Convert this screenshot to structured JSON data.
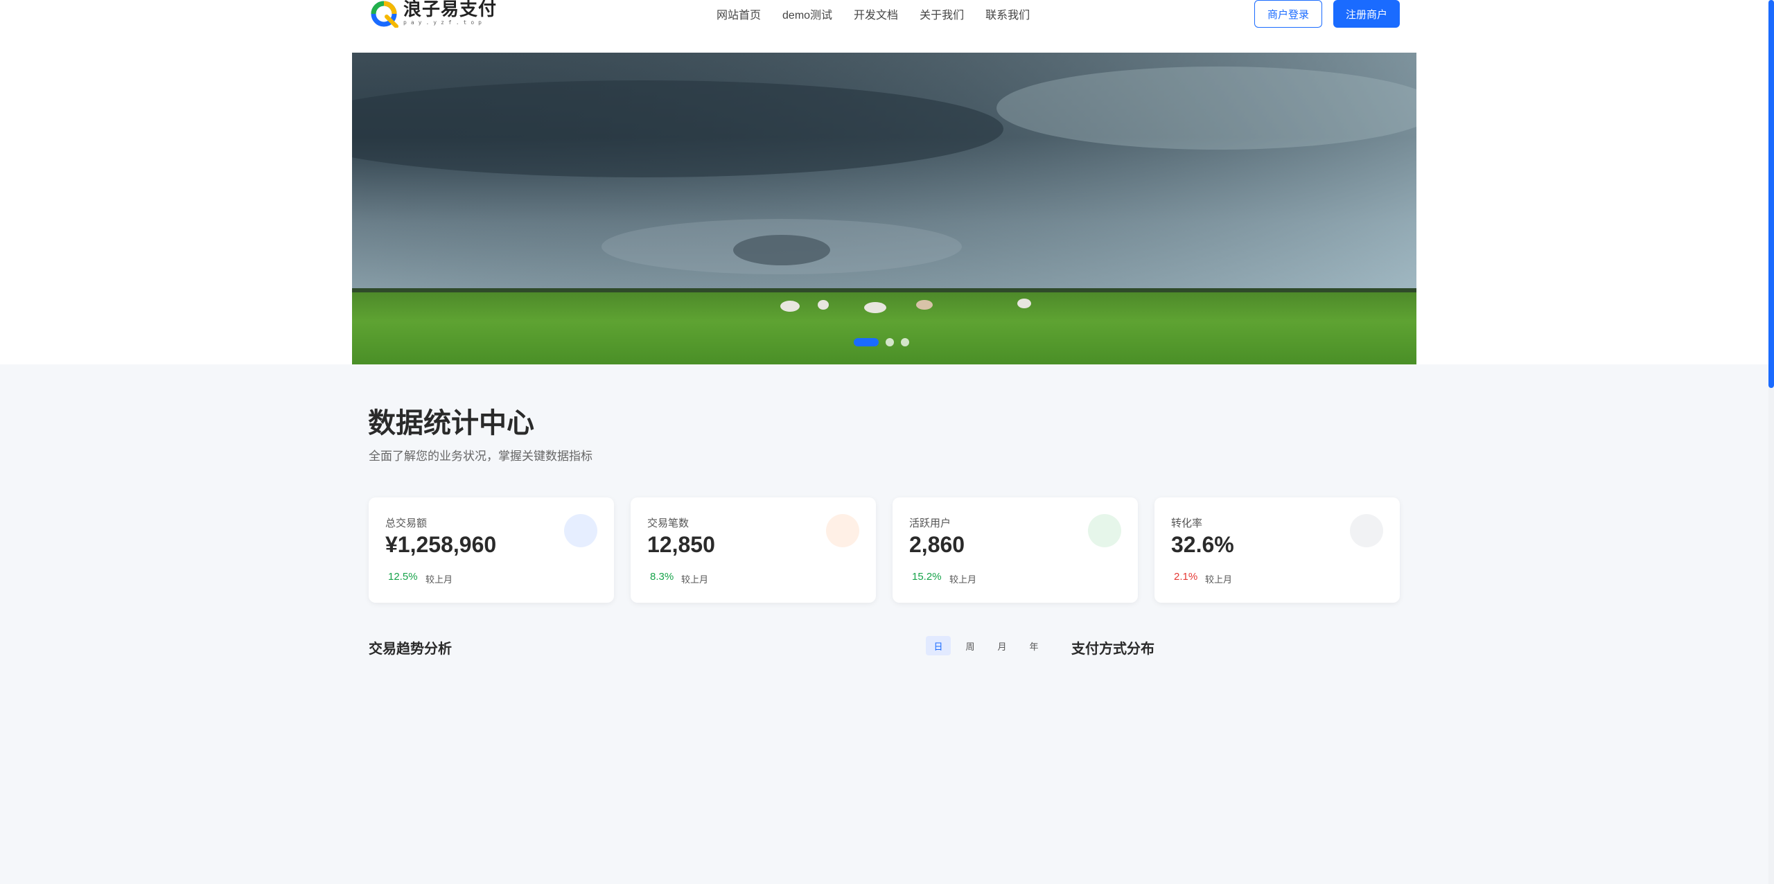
{
  "header": {
    "logo_title": "浪子易支付",
    "logo_sub": "pay.yzf.top",
    "nav": [
      "网站首页",
      "demo测试",
      "开发文档",
      "关于我们",
      "联系我们"
    ],
    "login_label": "商户登录",
    "register_label": "注册商户"
  },
  "banner": {
    "slide_count": 3,
    "active_slide": 1
  },
  "stats": {
    "title": "数据统计中心",
    "subtitle": "全面了解您的业务状况，掌握关键数据指标",
    "compare_label": "较上月",
    "cards": [
      {
        "label": "总交易额",
        "value": "¥1,258,960",
        "change": "12.5%",
        "trend": "up",
        "icon_color": "#e6eeff"
      },
      {
        "label": "交易笔数",
        "value": "12,850",
        "change": "8.3%",
        "trend": "up",
        "icon_color": "#fff0e6"
      },
      {
        "label": "活跃用户",
        "value": "2,860",
        "change": "15.2%",
        "trend": "up",
        "icon_color": "#e6f6ea"
      },
      {
        "label": "转化率",
        "value": "32.6%",
        "change": "2.1%",
        "trend": "down",
        "icon_color": "#f1f2f4"
      }
    ]
  },
  "charts": {
    "trend_title": "交易趋势分析",
    "payment_title": "支付方式分布",
    "periods": [
      "日",
      "周",
      "月",
      "年"
    ],
    "active_period": "日"
  },
  "colors": {
    "primary": "#1a6bff",
    "up": "#17a34a",
    "down": "#e53935"
  }
}
